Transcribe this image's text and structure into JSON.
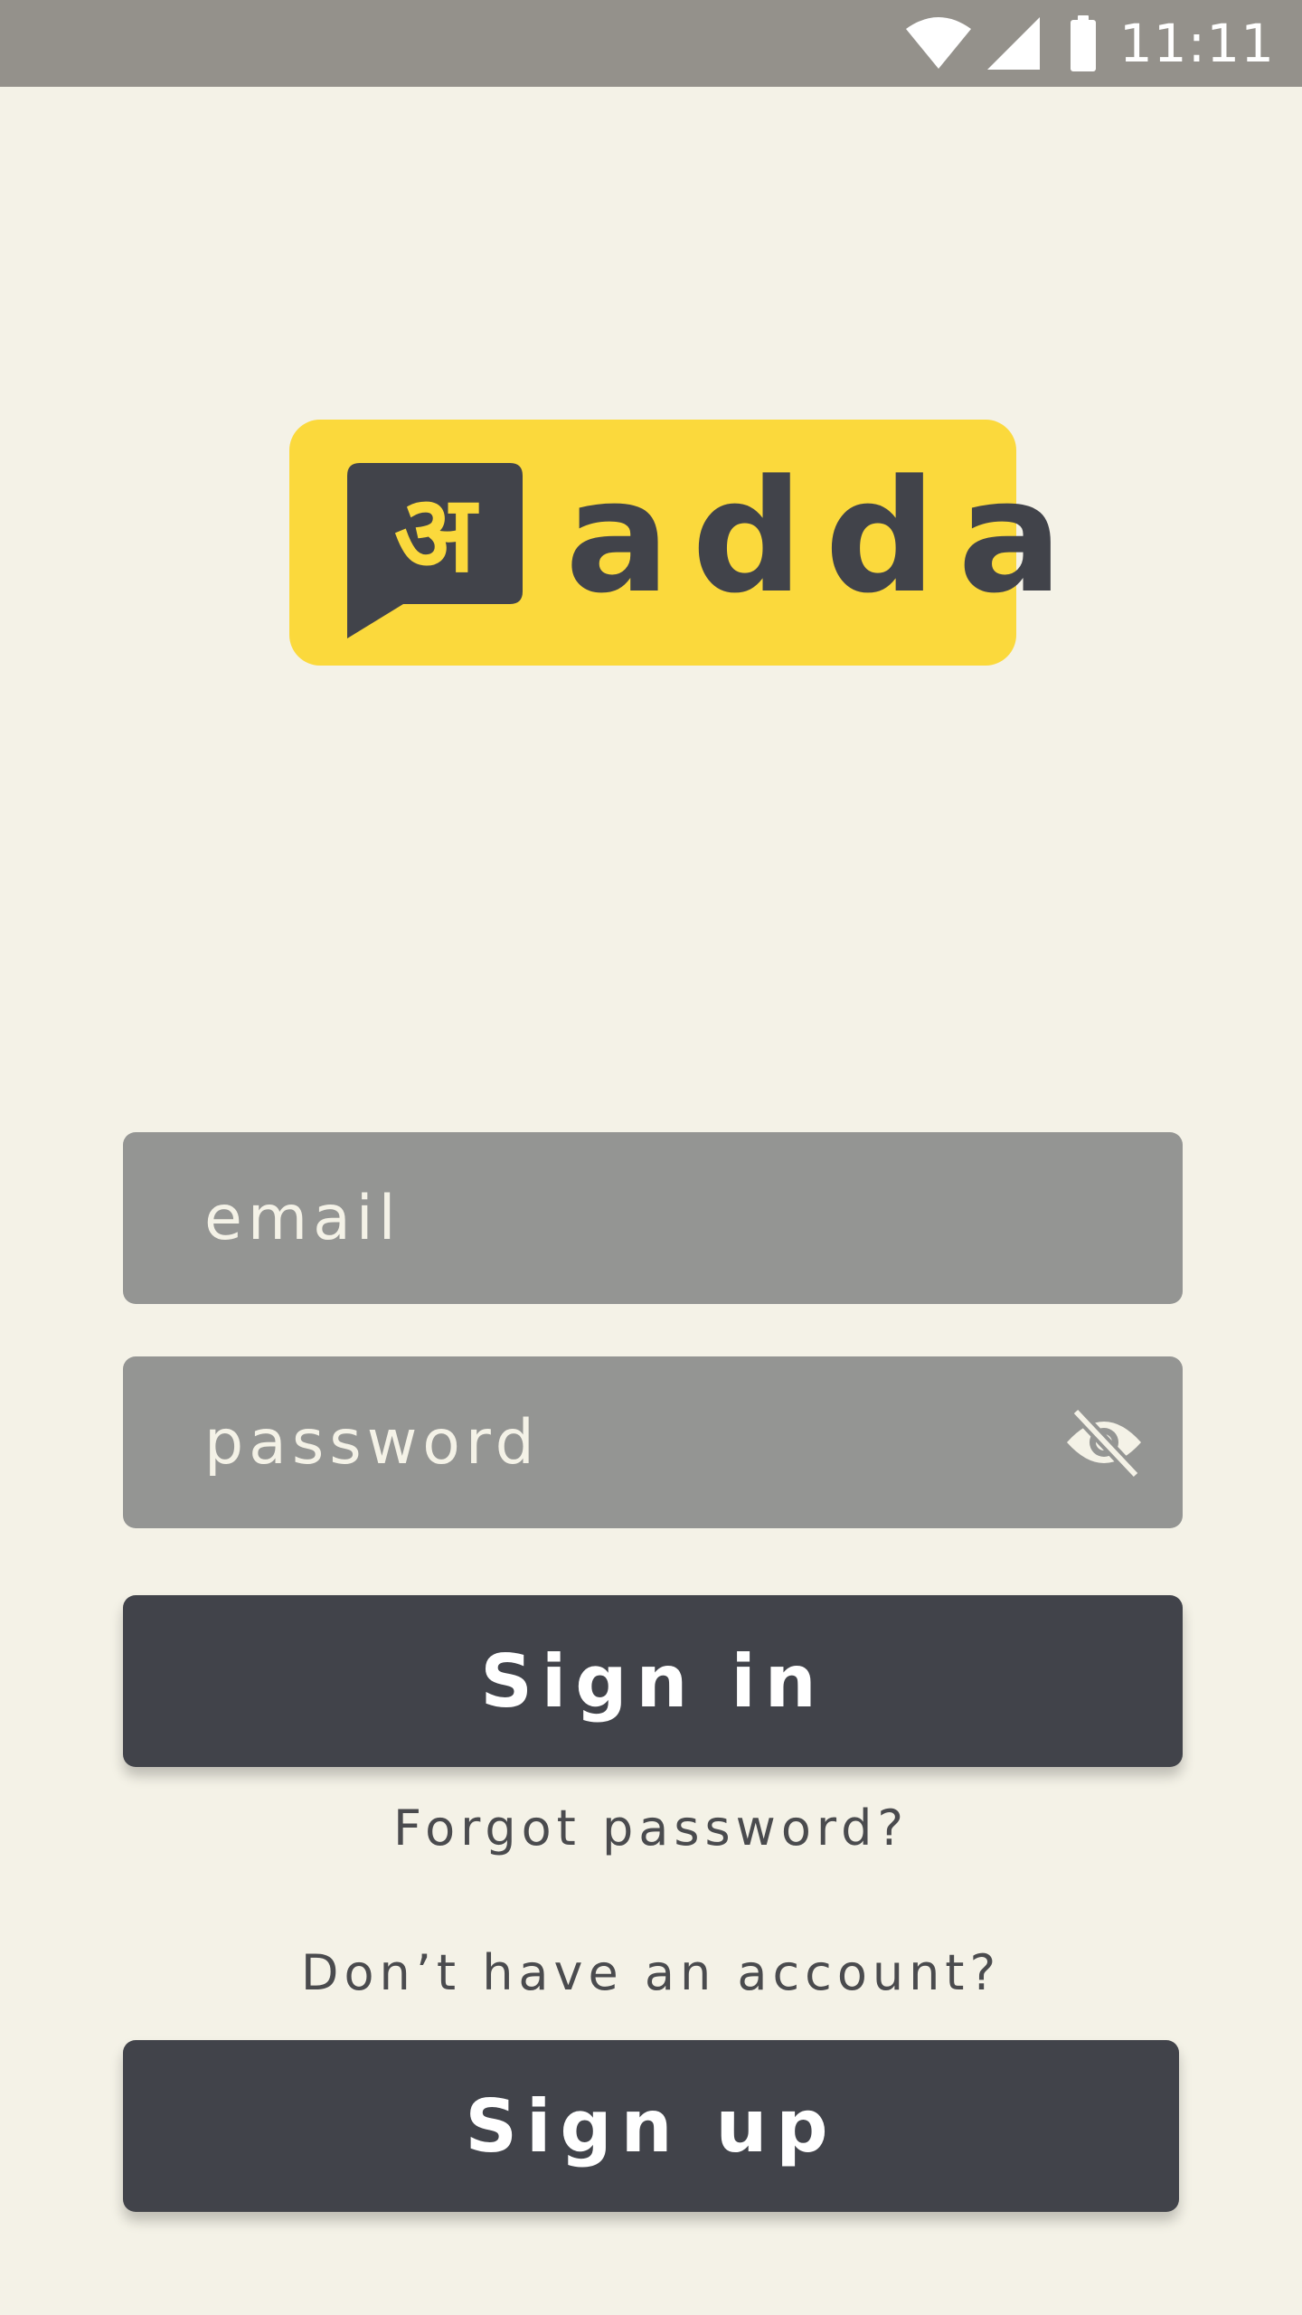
{
  "status_bar": {
    "time": "11:11",
    "icons": [
      "wifi-icon",
      "signal-icon",
      "battery-icon"
    ]
  },
  "logo": {
    "glyph": "अ",
    "wordmark": "adda"
  },
  "email_field": {
    "placeholder": "email",
    "value": ""
  },
  "password_field": {
    "placeholder": "password",
    "value": "",
    "toggle_icon": "eye-off-icon"
  },
  "sign_in_button": {
    "label": "Sign in"
  },
  "forgot_password_link": {
    "label": "Forgot password?"
  },
  "no_account_text": {
    "label": "Don’t have an account?"
  },
  "sign_up_button": {
    "label": "Sign up"
  },
  "colors": {
    "background": "#f4f2e7",
    "status_bar": "#94918b",
    "logo_yellow": "#fbd93c",
    "dark": "#41434a",
    "field_gray": "#949593"
  }
}
